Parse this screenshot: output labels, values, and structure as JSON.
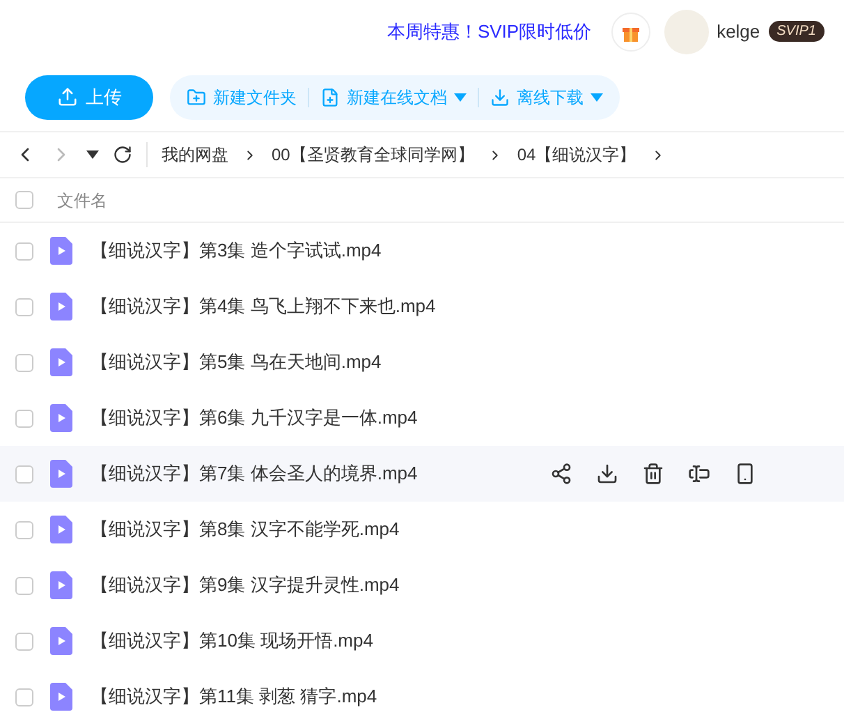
{
  "top_bar": {
    "promo": "本周特惠！SVIP限时低价",
    "username": "kelge",
    "vip_badge": "SVIP1"
  },
  "toolbar": {
    "upload": "上传",
    "actions": [
      {
        "label": "新建文件夹",
        "kind": "folder",
        "dropdown": false
      },
      {
        "label": "新建在线文档",
        "kind": "doc",
        "dropdown": true
      },
      {
        "label": "离线下载",
        "kind": "download",
        "dropdown": true
      }
    ]
  },
  "breadcrumb": [
    "我的网盘",
    "00【圣贤教育全球同学网】",
    "04【细说汉字】"
  ],
  "table": {
    "select_all_checked": false,
    "column": "文件名",
    "rows": [
      {
        "name": "【细说汉字】第3集 造个字试试.mp4",
        "hovered": false
      },
      {
        "name": "【细说汉字】第4集 鸟飞上翔不下来也.mp4",
        "hovered": false
      },
      {
        "name": "【细说汉字】第5集 鸟在天地间.mp4",
        "hovered": false
      },
      {
        "name": "【细说汉字】第6集 九千汉字是一体.mp4",
        "hovered": false
      },
      {
        "name": "【细说汉字】第7集 体会圣人的境界.mp4",
        "hovered": true
      },
      {
        "name": "【细说汉字】第8集 汉字不能学死.mp4",
        "hovered": false
      },
      {
        "name": "【细说汉字】第9集 汉字提升灵性.mp4",
        "hovered": false
      },
      {
        "name": "【细说汉字】第10集 现场开悟.mp4",
        "hovered": false
      },
      {
        "name": "【细说汉字】第11集 剥葱 猜字.mp4",
        "hovered": false
      }
    ]
  }
}
